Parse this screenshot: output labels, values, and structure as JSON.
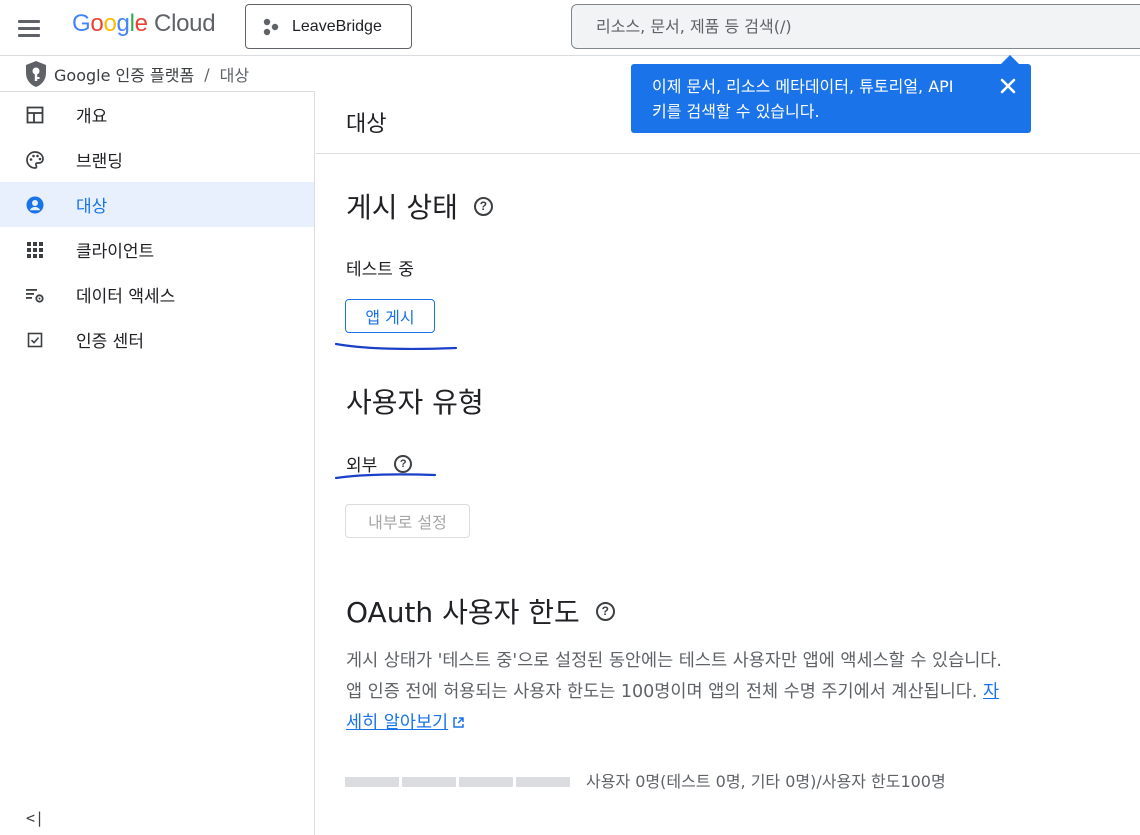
{
  "topbar": {
    "logo_google": "Google",
    "logo_cloud": "Cloud",
    "project_name": "LeaveBridge",
    "search_placeholder": "리소스, 문서, 제품 등 검색(/)"
  },
  "breadcrumb": {
    "product": "Google 인증 플랫폼",
    "separator": "/",
    "current": "대상"
  },
  "tooltip": {
    "message": "이제 문서, 리소스 메타데이터, 튜토리얼, API 키를 검색할 수 있습니다."
  },
  "sidebar": {
    "items": [
      {
        "label": "개요",
        "icon": "dashboard-icon",
        "active": false
      },
      {
        "label": "브랜딩",
        "icon": "palette-icon",
        "active": false
      },
      {
        "label": "대상",
        "icon": "account-circle-icon",
        "active": true
      },
      {
        "label": "클라이언트",
        "icon": "apps-grid-icon",
        "active": false
      },
      {
        "label": "데이터 액세스",
        "icon": "data-settings-icon",
        "active": false
      },
      {
        "label": "인증 센터",
        "icon": "check-box-icon",
        "active": false
      }
    ],
    "collapse_label": "<|"
  },
  "main": {
    "header_title": "대상",
    "publishing": {
      "title": "게시 상태",
      "status": "테스트 중",
      "publish_button": "앱 게시"
    },
    "user_type": {
      "title": "사용자 유형",
      "value": "외부",
      "make_internal_button": "내부로 설정"
    },
    "oauth": {
      "title": "OAuth 사용자 한도",
      "description": "게시 상태가 '테스트 중'으로 설정된 동안에는 테스트 사용자만 앱에 액세스할 수 있습니다. 앱 인증 전에 허용되는 사용자 한도는 100명이며 앱의 전체 수명 주기에서 계산됩니다.",
      "learn_more": "자세히 알아보기",
      "quota_text": "사용자 0명(테스트 0명, 기타 0명)/사용자 한도100명",
      "quota_used_fraction": 0
    }
  },
  "colors": {
    "accent": "#1a73e8",
    "tooltip_bg": "#1a73e8",
    "annotation": "#1a3fc9"
  }
}
